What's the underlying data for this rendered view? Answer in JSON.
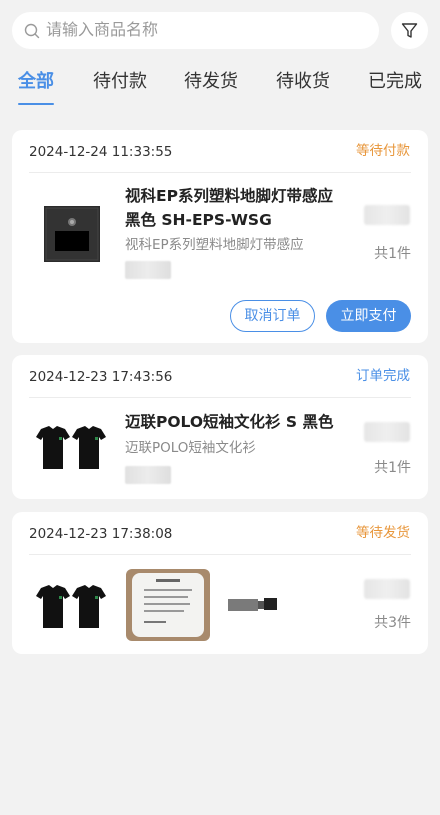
{
  "search": {
    "placeholder": "请输入商品名称"
  },
  "tabs": [
    {
      "label": "全部"
    },
    {
      "label": "待付款"
    },
    {
      "label": "待发货"
    },
    {
      "label": "待收货"
    },
    {
      "label": "已完成"
    }
  ],
  "active_tab": "全部",
  "colors": {
    "accent": "#4a8fe6",
    "pending": "#e8973c",
    "background": "#f2f2f2"
  },
  "orders": [
    {
      "date": "2024-12-24 11:33:55",
      "status": "等待付款",
      "product_title": "视科EP系列塑料地脚灯带感应黑色 SH-EPS-WSG",
      "product_title_line1": "视科EP系列塑料地脚灯带感应",
      "product_title_line2": "黑色 SH-EPS-WSG",
      "product_sub": "视科EP系列塑料地脚灯带感应",
      "count": "共1件",
      "buttons": {
        "cancel": "取消订单",
        "pay": "立即支付"
      }
    },
    {
      "date": "2024-12-23 17:43:56",
      "status": "订单完成",
      "product_title": "迈联POLO短袖文化衫 S 黑色",
      "product_sub": "迈联POLO短袖文化衫",
      "count": "共1件"
    },
    {
      "date": "2024-12-23 17:38:08",
      "status": "等待发货",
      "count": "共3件",
      "product_images": [
        "polo-shirt-image",
        "485-relay-device-image",
        "gray-cable-connector-image"
      ]
    }
  ]
}
